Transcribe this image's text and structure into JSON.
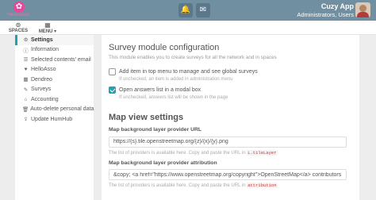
{
  "topbar": {
    "logo_text": "HelloAsso",
    "user_name": "Cuzy App",
    "user_role": "Administrators, Users",
    "bell_icon": "bell-icon",
    "inbox_icon": "inbox-icon"
  },
  "subbar": {
    "spaces_label": "SPACES",
    "menu_label": "MENU ▾"
  },
  "sidebar": {
    "items": [
      {
        "label": "Settings",
        "icon": "gear-icon",
        "glyph": "⚙"
      },
      {
        "label": "Information",
        "icon": "info-icon",
        "glyph": "ⓘ"
      },
      {
        "label": "Selected contents' email",
        "icon": "list-icon",
        "glyph": "☰"
      },
      {
        "label": "HelloAsso",
        "icon": "heart-icon",
        "glyph": "♥"
      },
      {
        "label": "Dendreo",
        "icon": "calendar-icon",
        "glyph": "▦"
      },
      {
        "label": "Surveys",
        "icon": "survey-icon",
        "glyph": "✎"
      },
      {
        "label": "Accounting",
        "icon": "bank-icon",
        "glyph": "⌂"
      },
      {
        "label": "Auto-delete personal data",
        "icon": "trash-icon",
        "glyph": "🗑"
      },
      {
        "label": "Update HumHub",
        "icon": "upload-icon",
        "glyph": "⇪"
      }
    ]
  },
  "main": {
    "title": "Survey module configuration",
    "description": "This module enables you to create surveys for all the network and in spaces",
    "option1_label": "Add item in top menu to manage and see global surveys",
    "option1_hint": "If unchecked, an item is added in administration menu",
    "option2_label": "Open answers list in a modal box",
    "option2_hint": "If unchecked, answers list will be shown in the page",
    "map_title": "Map view settings",
    "tile_label": "Map background layer provider URL",
    "tile_value": "https://{s}.tile.openstreetmap.org/{z}/{x}/{y}.png",
    "tile_hint_prefix": "The list of providers is available here. Copy and paste the URL in ",
    "tile_hint_code": "L.tileLayer",
    "attr_label": "Map background layer provider attribution",
    "attr_value": "&copy; <a href=\"https://www.openstreetmap.org/copyright\">OpenStreetMap</a> contributors",
    "attr_hint_prefix": "The list of providers is available here. Copy and paste the URL in ",
    "attr_hint_code": "attribution"
  },
  "colors": {
    "topbar": "#708fa0",
    "accent": "#21a1b3",
    "logo": "#e7469c"
  }
}
